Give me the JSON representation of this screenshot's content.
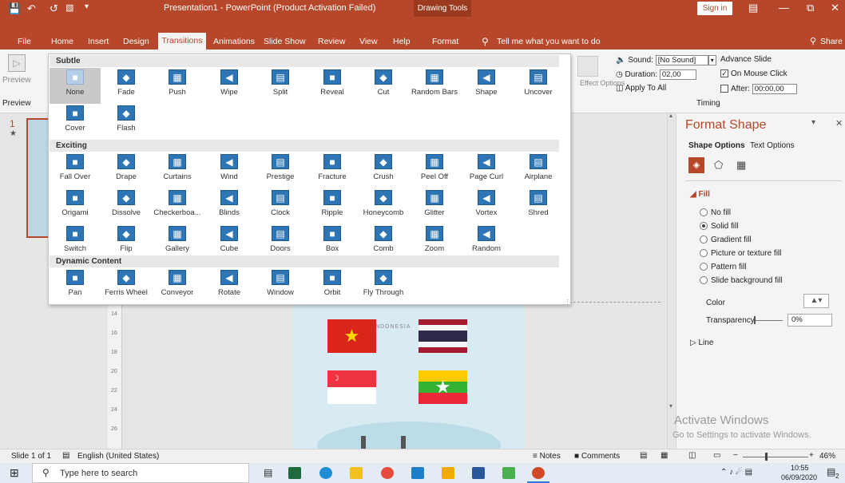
{
  "titlebar": {
    "title": "Presentation1 - PowerPoint (Product Activation Failed)",
    "context_tab": "Drawing Tools",
    "signin": "Sign in"
  },
  "menu": {
    "file": "File",
    "home": "Home",
    "insert": "Insert",
    "design": "Design",
    "transitions": "Transitions",
    "animations": "Animations",
    "slideshow": "Slide Show",
    "review": "Review",
    "view": "View",
    "help": "Help",
    "format": "Format",
    "tellme": "Tell me what you want to do",
    "share": "Share"
  },
  "ribbon": {
    "preview": "Preview",
    "preview_group": "Preview",
    "effect_options": "Effect Options",
    "sound_label": "Sound:",
    "sound_value": "[No Sound]",
    "duration_label": "Duration:",
    "duration_value": "02,00",
    "apply_all": "Apply To All",
    "advance_label": "Advance Slide",
    "on_click": "On Mouse Click",
    "after_label": "After:",
    "after_value": "00:00,00",
    "timing_group": "Timing"
  },
  "gallery": {
    "subtle_header": "Subtle",
    "subtle": [
      "None",
      "Fade",
      "Push",
      "Wipe",
      "Split",
      "Reveal",
      "Cut",
      "Random Bars",
      "Shape",
      "Uncover",
      "Cover",
      "Flash"
    ],
    "exciting_header": "Exciting",
    "exciting": [
      "Fall Over",
      "Drape",
      "Curtains",
      "Wind",
      "Prestige",
      "Fracture",
      "Crush",
      "Peel Off",
      "Page Curl",
      "Airplane",
      "Origami",
      "Dissolve",
      "Checkerboa...",
      "Blinds",
      "Clock",
      "Ripple",
      "Honeycomb",
      "Glitter",
      "Vortex",
      "Shred",
      "Switch",
      "Flip",
      "Gallery",
      "Cube",
      "Doors",
      "Box",
      "Comb",
      "Zoom",
      "Random"
    ],
    "dynamic_header": "Dynamic Content",
    "dynamic": [
      "Pan",
      "Ferris Wheel",
      "Conveyor",
      "Rotate",
      "Window",
      "Orbit",
      "Fly Through"
    ]
  },
  "slide": {
    "slide_number": "1",
    "map_label": "INDONESIA"
  },
  "ruler": {
    "marks": [
      "14",
      "16",
      "18",
      "20",
      "22",
      "24",
      "26"
    ]
  },
  "format_pane": {
    "title": "Format Shape",
    "tab_shape": "Shape Options",
    "tab_text": "Text Options",
    "fill_header": "Fill",
    "no_fill": "No fill",
    "solid_fill": "Solid fill",
    "gradient_fill": "Gradient fill",
    "picture_fill": "Picture or texture fill",
    "pattern_fill": "Pattern fill",
    "slide_bg_fill": "Slide background fill",
    "color_label": "Color",
    "transparency_label": "Transparency",
    "transparency_value": "0%",
    "line_header": "Line",
    "watermark_title": "Activate Windows",
    "watermark_sub": "Go to Settings to activate Windows."
  },
  "status": {
    "slide_of": "Slide 1 of 1",
    "language": "English (United States)",
    "notes": "Notes",
    "comments": "Comments",
    "zoom": "46%"
  },
  "taskbar": {
    "search_placeholder": "Type here to search",
    "time": "10:55",
    "date": "06/09/2020",
    "notif_count": "2"
  },
  "colors": {
    "accent": "#b7472a",
    "selected_tab_bg": "#f4f4f4",
    "icon_blue": "#2e75b6"
  }
}
